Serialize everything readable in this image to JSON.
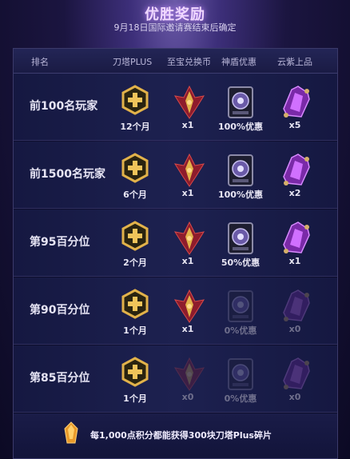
{
  "header": {
    "title": "优胜奖励",
    "subtitle": "9月18日国际邀请赛结束后确定"
  },
  "columns": [
    "排名",
    "刀塔PLUS",
    "至宝兑换币",
    "神盾优惠",
    "云紫上品"
  ],
  "rows": [
    {
      "rank": "前100名玩家",
      "plus": "12个月",
      "coin": "x1",
      "aegis": "100%优惠",
      "cloud": "x5",
      "coin_active": true,
      "aegis_active": true,
      "cloud_active": true
    },
    {
      "rank": "前1500名玩家",
      "plus": "6个月",
      "coin": "x1",
      "aegis": "100%优惠",
      "cloud": "x2",
      "coin_active": true,
      "aegis_active": true,
      "cloud_active": true
    },
    {
      "rank": "第95百分位",
      "plus": "2个月",
      "coin": "x1",
      "aegis": "50%优惠",
      "cloud": "x1",
      "coin_active": true,
      "aegis_active": true,
      "cloud_active": true
    },
    {
      "rank": "第90百分位",
      "plus": "1个月",
      "coin": "x1",
      "aegis": "0%优惠",
      "cloud": "x0",
      "coin_active": true,
      "aegis_active": false,
      "cloud_active": false
    },
    {
      "rank": "第85百分位",
      "plus": "1个月",
      "coin": "x0",
      "aegis": "0%优惠",
      "cloud": "x0",
      "coin_active": false,
      "aegis_active": false,
      "cloud_active": false
    }
  ],
  "footer": {
    "text": "每1,000点积分都能获得300块刀塔Plus碎片"
  },
  "icons": {
    "plus": "plus-hexagon-icon",
    "coin": "treasure-coin-icon",
    "aegis": "aegis-shield-icon",
    "cloud": "cloud-purple-item-icon",
    "shard": "plus-shard-icon"
  },
  "colors": {
    "gold": "#e2b24a",
    "crimson": "#b0283a",
    "purple": "#b04ce0"
  }
}
